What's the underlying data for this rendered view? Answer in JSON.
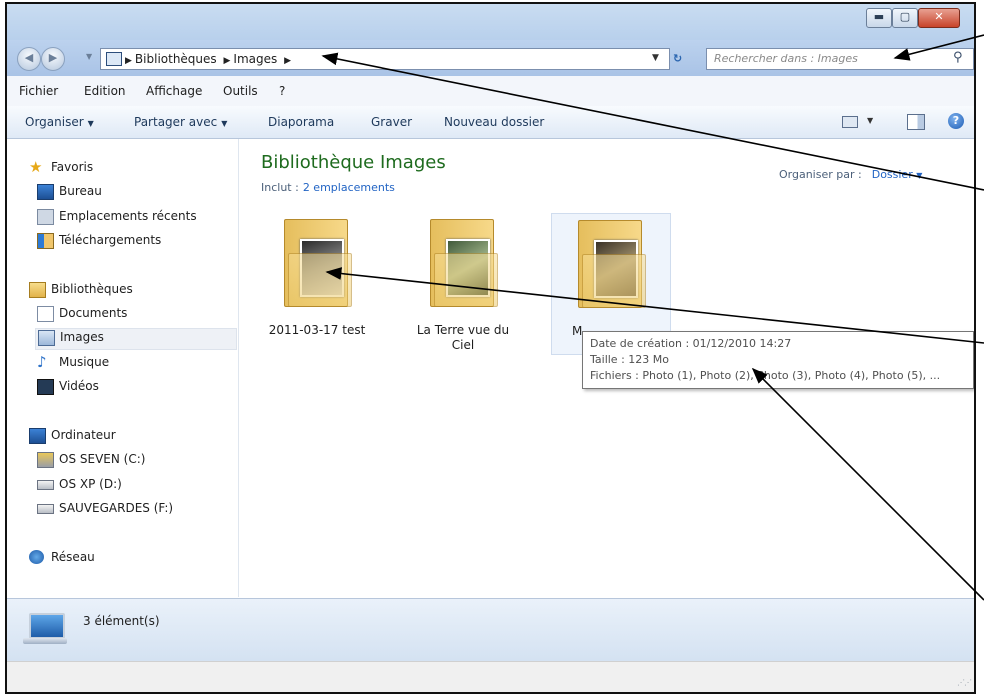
{
  "window": {
    "controls": {
      "minimize": "▬",
      "maximize": "▢",
      "close": "✕"
    }
  },
  "address": {
    "crumbs": [
      "Bibliothèques",
      "Images"
    ],
    "search_placeholder": "Rechercher dans : Images"
  },
  "menu": {
    "items": [
      "Fichier",
      "Edition",
      "Affichage",
      "Outils",
      "?"
    ]
  },
  "toolbar": {
    "organise": "Organiser",
    "share": "Partager avec",
    "slideshow": "Diaporama",
    "burn": "Graver",
    "new_folder": "Nouveau dossier"
  },
  "sidebar": {
    "favorites": {
      "label": "Favoris",
      "items": [
        "Bureau",
        "Emplacements récents",
        "Téléchargements"
      ]
    },
    "libraries": {
      "label": "Bibliothèques",
      "items": [
        "Documents",
        "Images",
        "Musique",
        "Vidéos"
      ],
      "selected": "Images"
    },
    "computer": {
      "label": "Ordinateur",
      "items": [
        "OS SEVEN (C:)",
        "OS XP (D:)",
        "SAUVEGARDES (F:)"
      ]
    },
    "network": {
      "label": "Réseau"
    }
  },
  "content": {
    "title": "Bibliothèque Images",
    "includes_label": "Inclut :",
    "includes_link": "2 emplacements",
    "arrange_label": "Organiser par :",
    "arrange_value": "Dossier",
    "folders": [
      {
        "name": "2011-03-17 test"
      },
      {
        "name": "La Terre vue du Ciel"
      },
      {
        "name": "M"
      }
    ]
  },
  "tooltip": {
    "line1": "Date de création : 01/12/2010 14:27",
    "line2": "Taille : 123 Mo",
    "line3": "Fichiers : Photo (1), Photo (2), Photo (3), Photo (4), Photo (5), ..."
  },
  "status": {
    "count": "3 élément(s)"
  }
}
